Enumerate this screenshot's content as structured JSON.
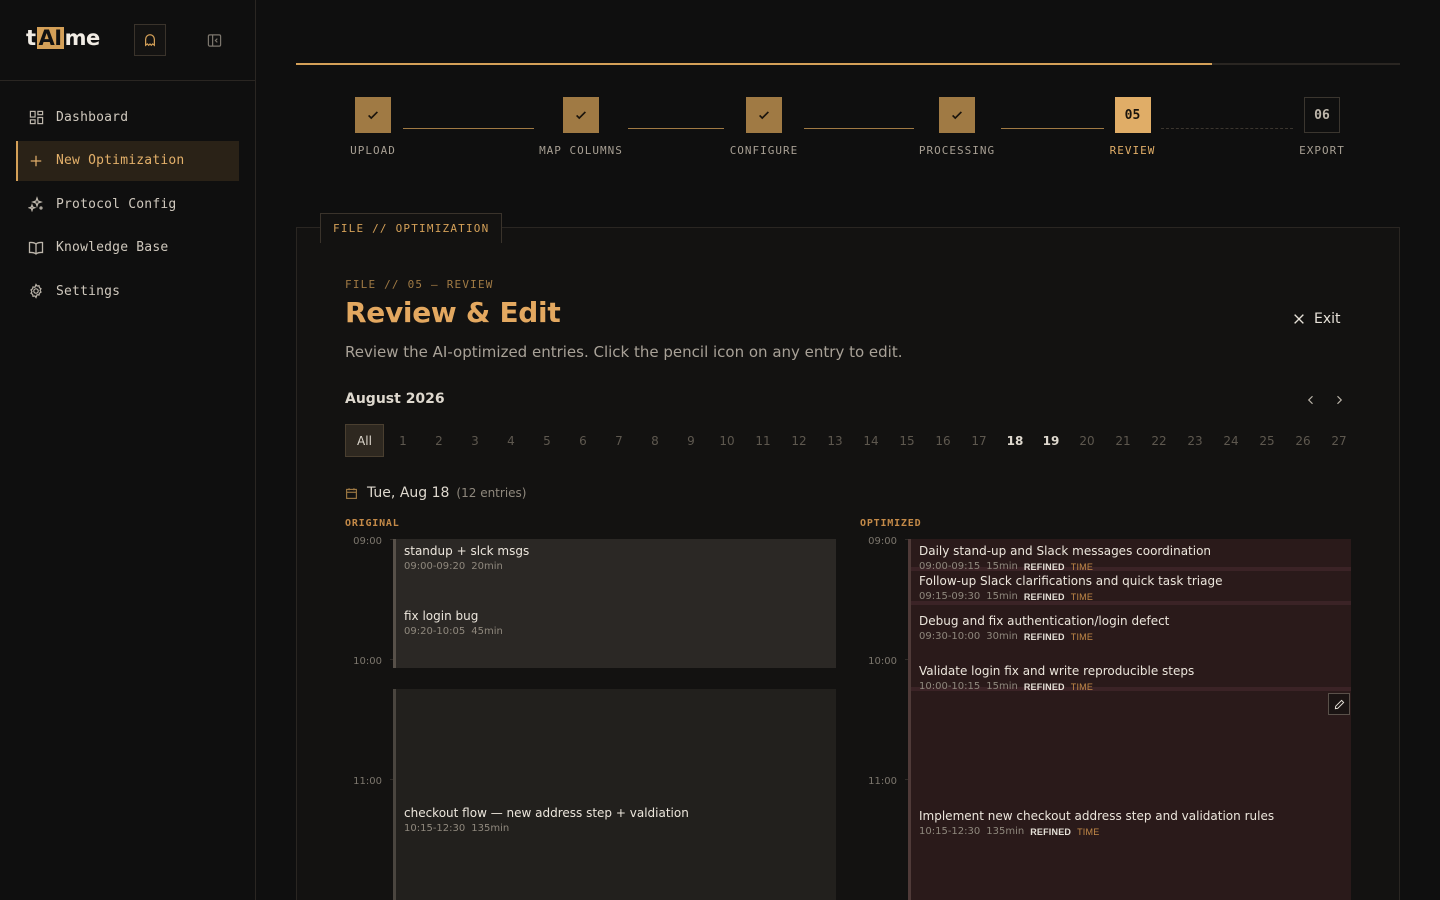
{
  "brand": {
    "pre": "t",
    "ai": "AI",
    "post": "me"
  },
  "sidebar": {
    "items": [
      {
        "label": "Dashboard",
        "icon": "grid-icon"
      },
      {
        "label": "New Optimization",
        "icon": "plus-icon",
        "active": true
      },
      {
        "label": "Protocol Config",
        "icon": "sparkles-icon"
      },
      {
        "label": "Knowledge Base",
        "icon": "book-icon"
      },
      {
        "label": "Settings",
        "icon": "gear-icon"
      }
    ]
  },
  "stepper": {
    "progress": 0.83,
    "steps": [
      {
        "label": "UPLOAD",
        "state": "done"
      },
      {
        "label": "MAP COLUMNS",
        "state": "done"
      },
      {
        "label": "CONFIGURE",
        "state": "done"
      },
      {
        "label": "PROCESSING",
        "state": "done"
      },
      {
        "label": "REVIEW",
        "state": "current",
        "num": "05"
      },
      {
        "label": "EXPORT",
        "state": "pending",
        "num": "06"
      }
    ]
  },
  "card": {
    "tab": "FILE // OPTIMIZATION",
    "crumb": "FILE // 05 — REVIEW",
    "title": "Review & Edit",
    "subtitle": "Review the AI-optimized entries. Click the pencil icon on any entry to edit.",
    "exit_label": "Exit"
  },
  "calendar": {
    "month": "August 2026",
    "all_label": "All",
    "days": [
      "1",
      "2",
      "3",
      "4",
      "5",
      "6",
      "7",
      "8",
      "9",
      "10",
      "11",
      "12",
      "13",
      "14",
      "15",
      "16",
      "17",
      "18",
      "19",
      "20",
      "21",
      "22",
      "23",
      "24",
      "25",
      "26",
      "27"
    ],
    "bold_days": [
      "18",
      "19"
    ]
  },
  "date": {
    "label": "Tue, Aug 18",
    "count": "(12 entries)"
  },
  "columns": {
    "original": "ORIGINAL",
    "optimized": "OPTIMIZED"
  },
  "hours": [
    "09:00",
    "10:00",
    "11:00"
  ],
  "original": [
    {
      "title": "standup + slck msgs",
      "time": "09:00-09:20",
      "dur": "20min"
    },
    {
      "title": "fix login bug",
      "time": "09:20-10:05",
      "dur": "45min"
    },
    {
      "title": "checkout flow — new address step + valdiation",
      "time": "10:15-12:30",
      "dur": "135min"
    }
  ],
  "optimized": [
    {
      "title": "Daily stand-up and Slack messages coordination",
      "time": "09:00-09:15",
      "dur": "15min",
      "tag": "REFINED",
      "tag2": "TIME"
    },
    {
      "title": "Follow-up Slack clarifications and quick task triage",
      "time": "09:15-09:30",
      "dur": "15min",
      "tag": "REFINED",
      "tag2": "TIME"
    },
    {
      "title": "Debug and fix authentication/login defect",
      "time": "09:30-10:00",
      "dur": "30min",
      "tag": "REFINED",
      "tag2": "TIME"
    },
    {
      "title": "Validate login fix and write reproducible steps",
      "time": "10:00-10:15",
      "dur": "15min",
      "tag": "REFINED",
      "tag2": "TIME"
    },
    {
      "title": "Implement new checkout address step and validation rules",
      "time": "10:15-12:30",
      "dur": "135min",
      "tag": "REFINED",
      "tag2": "TIME"
    }
  ],
  "colors": {
    "accent": "#d4a058",
    "accent_bright": "#e3a860",
    "bg": "#0f0f0f",
    "card": "#131211"
  }
}
